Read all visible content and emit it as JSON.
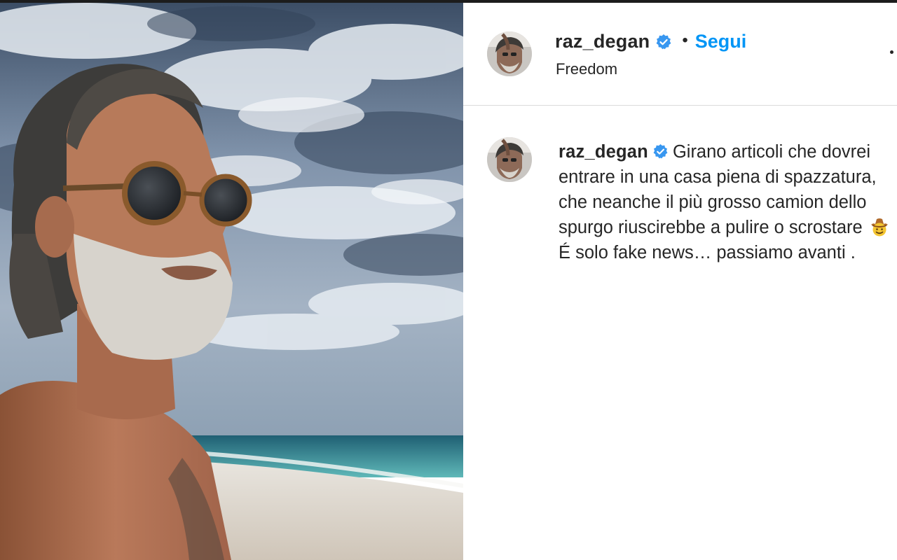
{
  "post": {
    "photo_icon": "beach-portrait-photo",
    "username": "raz_degan",
    "verified_icon": "verified-badge-icon",
    "separator": "•",
    "follow_label": "Segui",
    "location": "Freedom",
    "caption": {
      "username": "raz_degan",
      "text_before_emoji": "Girano articoli che dovrei entrare in una casa piena di spazzatura, che neanche il più grosso camion dello spurgo riuscirebbe a pulire o scrostare",
      "emoji": "cowboy-hat-face-emoji",
      "text_after_emoji": "É solo fake news… passiamo avanti ."
    }
  },
  "colors": {
    "link_blue": "#0095f6",
    "verified_blue": "#3897f0",
    "text": "#262626",
    "divider": "#dbdbdb"
  }
}
